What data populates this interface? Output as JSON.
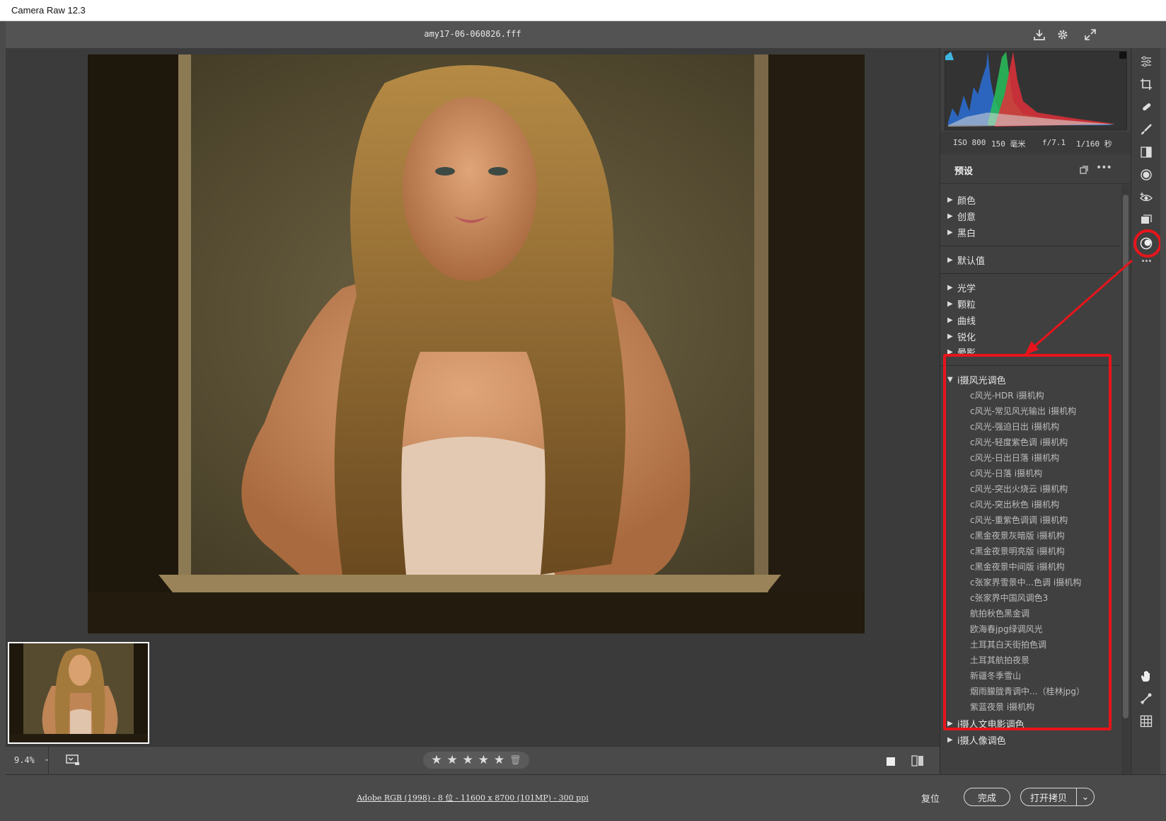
{
  "window": {
    "title": "Camera Raw 12.3"
  },
  "topbar": {
    "filename": "amy17-06-060826.fff"
  },
  "exif": {
    "iso": "ISO 800",
    "focal": "150 毫米",
    "aperture": "f/7.1",
    "shutter": "1/160 秒"
  },
  "presets": {
    "header": "预设",
    "groups_collapsed_a": [
      {
        "label": "颜色"
      },
      {
        "label": "创意"
      },
      {
        "label": "黑白"
      }
    ],
    "group_default": {
      "label": "默认值"
    },
    "groups_collapsed_b": [
      {
        "label": "光学"
      },
      {
        "label": "颗粒"
      },
      {
        "label": "曲线"
      },
      {
        "label": "锐化"
      },
      {
        "label": "晕影"
      }
    ],
    "expanded_group": {
      "label": "i摄风光调色",
      "items": [
        "c风光-HDR i摄机构",
        "c风光-常见风光输出 i摄机构",
        "c风光-强迫日出 i摄机构",
        "c风光-轻度紫色调 i摄机构",
        "c风光-日出日落 i摄机构",
        "c风光-日落 i摄机构",
        "c风光-突出火烧云 i摄机构",
        "c风光-突出秋色 i摄机构",
        "c风光-重紫色调调 i摄机构",
        "c黑金夜景灰暗版 i摄机构",
        "c黑金夜景明亮版 i摄机构",
        "c黑金夜景中间版 i摄机构",
        "c张家界雪景中...色调 i摄机构",
        "c张家界中国风调色3",
        "航拍秋色黑金调",
        "欧海春jpg绿调风光",
        "土耳其白天街拍色调",
        "土耳其航拍夜景",
        "新疆冬季雪山",
        "烟雨朦胧青调中...（桂林jpg）",
        "紫蓝夜景 i摄机构"
      ]
    },
    "groups_collapsed_c": [
      {
        "label": "i摄人文电影调色"
      },
      {
        "label": "i摄人像调色"
      }
    ]
  },
  "previewbar": {
    "zoom": "9.4%",
    "stars": [
      "★",
      "★",
      "★",
      "★",
      "★"
    ],
    "trash": "🗑"
  },
  "footer": {
    "info": "Adobe RGB (1998) - 8 位 - 11600 x 8700 (101MP) - 300 ppi",
    "reset": "复位",
    "done": "完成",
    "open_copy": "打开拷贝",
    "dropdown": "⌄"
  },
  "colors": {
    "annotation_red": "#e8141b",
    "panel": "#404040",
    "toolbar": "#535353"
  }
}
